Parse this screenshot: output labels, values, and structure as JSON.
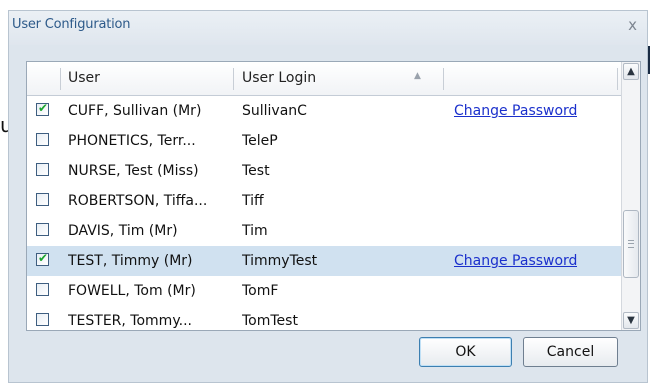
{
  "background": {
    "fragment_text": "u"
  },
  "dialog": {
    "title": "User Configuration",
    "close_glyph": "x"
  },
  "grid": {
    "columns": [
      "User",
      "User Login",
      ""
    ],
    "sort_indicator": "up-arrow-icon",
    "rows": [
      {
        "checked": true,
        "user": "CUFF, Sullivan (Mr)",
        "login": "SullivanC",
        "action": "Change Password",
        "selected": false
      },
      {
        "checked": false,
        "user": "PHONETICS, Terr...",
        "login": "TeleP",
        "action": "",
        "selected": false
      },
      {
        "checked": false,
        "user": "NURSE, Test (Miss)",
        "login": "Test",
        "action": "",
        "selected": false
      },
      {
        "checked": false,
        "user": "ROBERTSON, Tiffa...",
        "login": "Tiff",
        "action": "",
        "selected": false
      },
      {
        "checked": false,
        "user": "DAVIS, Tim (Mr)",
        "login": "Tim",
        "action": "",
        "selected": false
      },
      {
        "checked": true,
        "user": "TEST, Timmy (Mr)",
        "login": "TimmyTest",
        "action": "Change Password",
        "selected": true
      },
      {
        "checked": false,
        "user": "FOWELL, Tom (Mr)",
        "login": "TomF",
        "action": "",
        "selected": false
      },
      {
        "checked": false,
        "user": "TESTER, Tommy...",
        "login": "TomTest",
        "action": "",
        "selected": false
      }
    ],
    "checkmark_glyph": "✔"
  },
  "scrollbar": {
    "up_glyph": "▲",
    "down_glyph": "▼",
    "thumb_position": 0.7
  },
  "buttons": {
    "ok": "OK",
    "cancel": "Cancel"
  },
  "colors": {
    "dialog_bg": "#dde5ed",
    "title_text": "#2d5a8a",
    "selected_row": "#d0e1f0",
    "link": "#1b30cc",
    "check": "#1aa52e"
  }
}
